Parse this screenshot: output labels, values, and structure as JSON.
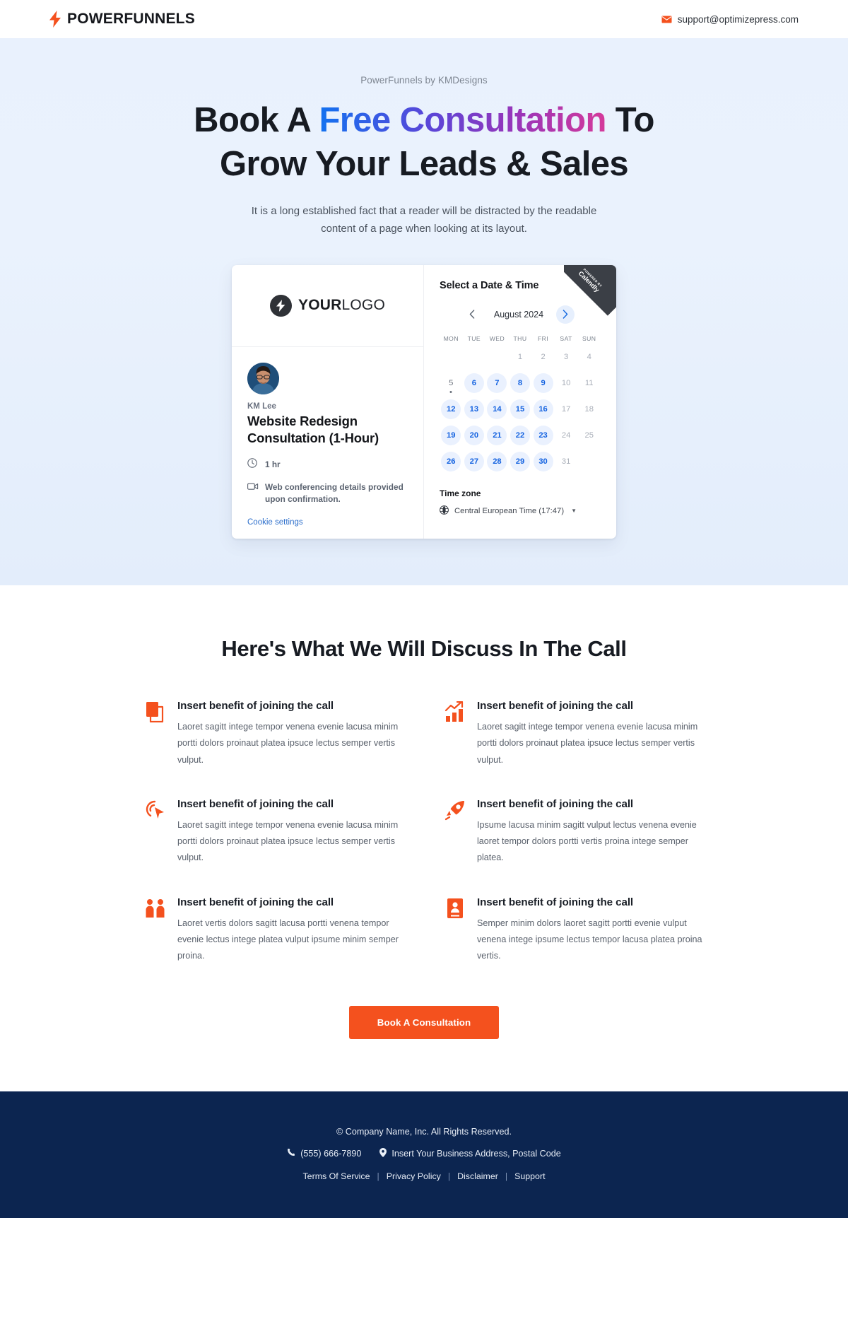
{
  "topbar": {
    "brand_bold": "POWER",
    "brand_light": "FUNNELS",
    "logo_icon": "lightning-bolt-icon",
    "email": "support@optimizepress.com",
    "email_icon": "envelope-icon"
  },
  "hero": {
    "eyebrow": "PowerFunnels by KMDesigns",
    "headline_part1": "Book A ",
    "headline_gradient": "Free Consultation",
    "headline_part2": " To",
    "headline_line2": "Grow Your Leads & Sales",
    "subtext": "It is a long established fact that a reader will be distracted by the readable content of a page when looking at its layout.",
    "gradient_start": "#1272f0",
    "gradient_end": "#d53a9a",
    "background": "#e9f1fd"
  },
  "calendly": {
    "ribbon_small": "POWERED BY",
    "ribbon_brand": "Calendly",
    "logo_bold": "YOUR",
    "logo_light": "LOGO",
    "host_name": "KM Lee",
    "event_title": "Website Redesign Consultation (1-Hour)",
    "duration": "1 hr",
    "duration_icon": "clock-icon",
    "conferencing": "Web conferencing details provided upon confirmation.",
    "conferencing_icon": "video-camera-icon",
    "cookie_settings": "Cookie settings",
    "select_title": "Select a Date & Time",
    "month": "August 2024",
    "prev_icon": "chevron-left-icon",
    "next_icon": "chevron-right-icon",
    "dow": [
      "MON",
      "TUE",
      "WED",
      "THU",
      "FRI",
      "SAT",
      "SUN"
    ],
    "weeks": [
      [
        {
          "n": "",
          "state": "empty"
        },
        {
          "n": "",
          "state": "empty"
        },
        {
          "n": "",
          "state": "empty"
        },
        {
          "n": "1",
          "state": "dim"
        },
        {
          "n": "2",
          "state": "dim"
        },
        {
          "n": "3",
          "state": "dim"
        },
        {
          "n": "4",
          "state": "dim"
        }
      ],
      [
        {
          "n": "5",
          "state": "today"
        },
        {
          "n": "6",
          "state": "avail"
        },
        {
          "n": "7",
          "state": "avail"
        },
        {
          "n": "8",
          "state": "avail"
        },
        {
          "n": "9",
          "state": "avail"
        },
        {
          "n": "10",
          "state": "dim"
        },
        {
          "n": "11",
          "state": "dim"
        }
      ],
      [
        {
          "n": "12",
          "state": "avail"
        },
        {
          "n": "13",
          "state": "avail"
        },
        {
          "n": "14",
          "state": "avail"
        },
        {
          "n": "15",
          "state": "avail"
        },
        {
          "n": "16",
          "state": "avail"
        },
        {
          "n": "17",
          "state": "dim"
        },
        {
          "n": "18",
          "state": "dim"
        }
      ],
      [
        {
          "n": "19",
          "state": "avail"
        },
        {
          "n": "20",
          "state": "avail"
        },
        {
          "n": "21",
          "state": "avail"
        },
        {
          "n": "22",
          "state": "avail"
        },
        {
          "n": "23",
          "state": "avail"
        },
        {
          "n": "24",
          "state": "dim"
        },
        {
          "n": "25",
          "state": "dim"
        }
      ],
      [
        {
          "n": "26",
          "state": "avail"
        },
        {
          "n": "27",
          "state": "avail"
        },
        {
          "n": "28",
          "state": "avail"
        },
        {
          "n": "29",
          "state": "avail"
        },
        {
          "n": "30",
          "state": "avail"
        },
        {
          "n": "31",
          "state": "dim"
        },
        {
          "n": "",
          "state": "empty"
        }
      ]
    ],
    "timezone_label": "Time zone",
    "timezone_value": "Central European Time (17:47)",
    "timezone_icon": "globe-icon"
  },
  "benefits": {
    "section_title": "Here's What We Will Discuss In The Call",
    "items": [
      {
        "icon": "documents-copy-icon",
        "title": "Insert benefit of joining the call",
        "text": "Laoret sagitt intege tempor venena evenie lacusa minim portti dolors proinaut platea ipsuce lectus semper vertis vulput."
      },
      {
        "icon": "bar-chart-growth-icon",
        "title": "Insert benefit of joining the call",
        "text": "Laoret sagitt intege tempor venena evenie lacusa minim portti dolors proinaut platea ipsuce lectus semper vertis vulput."
      },
      {
        "icon": "cursor-click-icon",
        "title": "Insert benefit of joining the call",
        "text": "Laoret sagitt intege tempor venena evenie lacusa minim portti dolors proinaut platea ipsuce lectus semper vertis vulput."
      },
      {
        "icon": "rocket-icon",
        "title": "Insert benefit of joining the call",
        "text": "Ipsume lacusa minim sagitt vulput lectus venena evenie laoret tempor dolors portti vertis proina intege semper platea."
      },
      {
        "icon": "people-group-icon",
        "title": "Insert benefit of joining the call",
        "text": "Laoret vertis dolors sagitt lacusa portti venena tempor evenie lectus intege platea vulput ipsume minim semper proina."
      },
      {
        "icon": "id-badge-icon",
        "title": "Insert benefit of joining the call",
        "text": "Semper minim dolors laoret sagitt portti evenie vulput venena intege ipsume lectus tempor lacusa platea proina vertis."
      }
    ],
    "cta_label": "Book A Consultation",
    "cta_color": "#f4511e"
  },
  "footer": {
    "copyright": "© Company Name, Inc. All Rights Reserved.",
    "phone": "(555) 666-7890",
    "phone_icon": "phone-icon",
    "address": "Insert Your Business Address, Postal Code",
    "address_icon": "map-pin-icon",
    "links": [
      "Terms Of Service",
      "Privacy Policy",
      "Disclaimer",
      "Support"
    ],
    "link_separator": "|",
    "background": "#0c2550"
  }
}
